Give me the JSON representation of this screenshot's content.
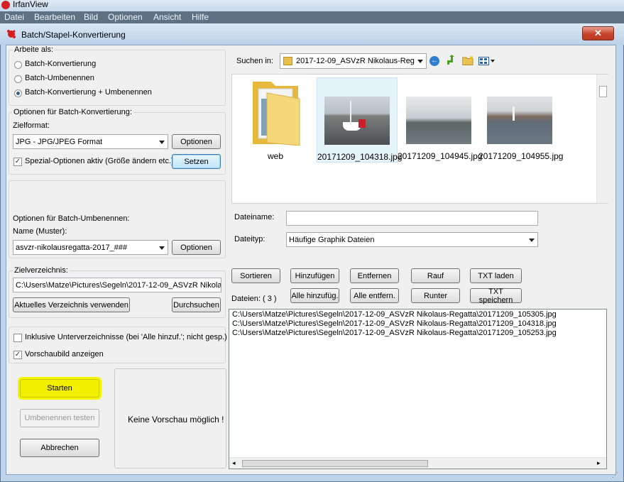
{
  "app": {
    "title": "IrfanView",
    "menu": [
      "Datei",
      "Bearbeiten",
      "Bild",
      "Optionen",
      "Ansicht",
      "Hilfe"
    ]
  },
  "dialog": {
    "title": "Batch/Stapel-Konvertierung",
    "close_symbol": "✕",
    "work_as": {
      "label": "Arbeite als:",
      "options": [
        "Batch-Konvertierung",
        "Batch-Umbenennen",
        "Batch-Konvertierung + Umbenennen"
      ],
      "selected": "Batch-Konvertierung + Umbenennen"
    },
    "convert_options": {
      "label": "Optionen für Batch-Konvertierung:",
      "format_label": "Zielformat:",
      "format_value": "JPG - JPG/JPEG Format",
      "options_button": "Optionen",
      "special_label": "Spezial-Optionen aktiv (Größe ändern etc.)",
      "special_checked": true,
      "set_button": "Setzen"
    },
    "rename_options": {
      "label": "Optionen für Batch-Umbenennen:",
      "pattern_label": "Name (Muster):",
      "pattern_value": "asvzr-nikolausregatta-2017_###",
      "options_button": "Optionen"
    },
    "target_dir": {
      "label": "Zielverzeichnis:",
      "value": "C:\\Users\\Matze\\Pictures\\Segeln\\2017-12-09_ASVzR Nikola",
      "use_current_button": "Aktuelles Verzeichnis verwenden",
      "browse_button": "Durchsuchen"
    },
    "include_subdirs": {
      "label": "Inklusive Unterverzeichnisse (bei 'Alle hinzuf.'; nicht gesp.)",
      "checked": false
    },
    "show_preview": {
      "label": "Vorschaubild anzeigen",
      "checked": true
    },
    "start_button": "Starten",
    "test_rename_button": "Umbenennen testen",
    "cancel_button": "Abbrechen",
    "preview_text": "Keine Vorschau möglich !",
    "look_in": {
      "label": "Suchen in:",
      "value": "2017-12-09_ASVzR Nikolaus-Reg"
    },
    "files": [
      {
        "name": "web",
        "kind": "folder"
      },
      {
        "name": "20171209_104318.jpg",
        "kind": "image",
        "selected": true
      },
      {
        "name": "20171209_104945.jpg",
        "kind": "image"
      },
      {
        "name": "20171209_104955.jpg",
        "kind": "image"
      }
    ],
    "filename": {
      "label": "Dateiname:",
      "value": ""
    },
    "filetype": {
      "label": "Dateityp:",
      "value": "Häufige Graphik Dateien"
    },
    "buttons": {
      "sort": "Sortieren",
      "add": "Hinzufügen",
      "remove": "Entfernen",
      "up": "Rauf",
      "load_txt": "TXT laden",
      "add_all": "Alle hinzufüg.",
      "remove_all": "Alle entfern.",
      "down": "Runter",
      "save_txt": "TXT speichern"
    },
    "files_count_label": "Dateien:  ( 3 )",
    "file_list": [
      "C:\\Users\\Matze\\Pictures\\Segeln\\2017-12-09_ASVzR Nikolaus-Regatta\\20171209_105305.jpg",
      "C:\\Users\\Matze\\Pictures\\Segeln\\2017-12-09_ASVzR Nikolaus-Regatta\\20171209_104318.jpg",
      "C:\\Users\\Matze\\Pictures\\Segeln\\2017-12-09_ASVzR Nikolaus-Regatta\\20171209_105253.jpg"
    ]
  },
  "colors": {
    "start_highlight": "#f5f500",
    "selection": "#cce8ff"
  }
}
